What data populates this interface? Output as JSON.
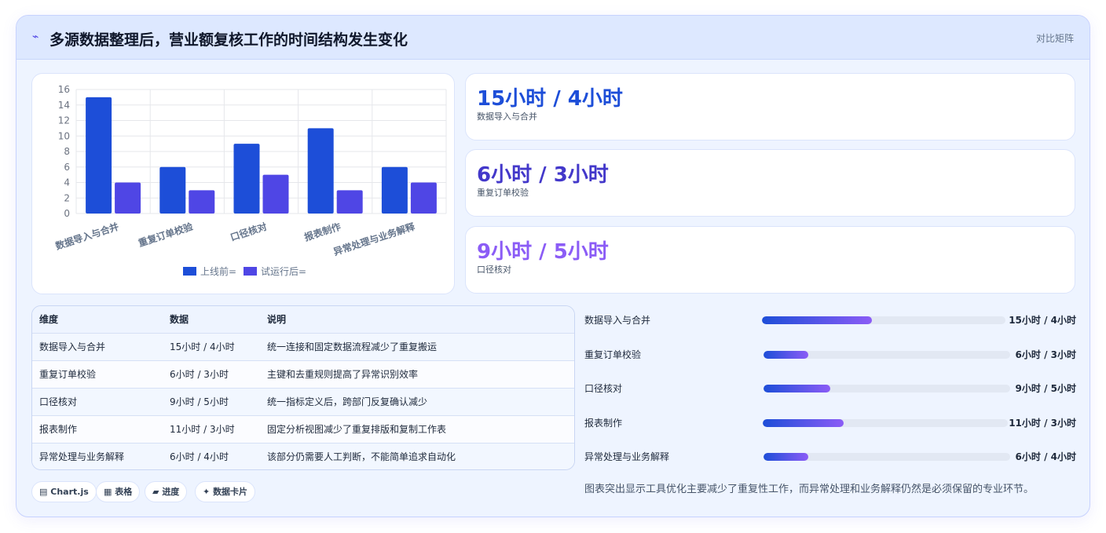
{
  "header": {
    "icon": "sparkline-icon",
    "title": "多源数据整理后，营业额复核工作的时间结构发生变化",
    "tag": "对比矩阵"
  },
  "colors": {
    "before": "#1d4ed8",
    "after": "#4f46e5",
    "stat1": "#1d4ed8",
    "stat2": "#4338ca",
    "stat3": "#8b5cf6"
  },
  "chart_data": {
    "type": "bar",
    "categories": [
      "数据导入与合并",
      "重复订单校验",
      "口径核对",
      "报表制作",
      "异常处理与业务解释"
    ],
    "series": [
      {
        "name": "上线前=",
        "values": [
          15,
          6,
          9,
          11,
          6
        ]
      },
      {
        "name": "试运行后=",
        "values": [
          4,
          3,
          5,
          3,
          4
        ]
      }
    ],
    "ylim": [
      0,
      16
    ],
    "yticks": [
      0,
      2,
      4,
      6,
      8,
      10,
      12,
      14,
      16
    ],
    "grid": true,
    "legend": "bottom"
  },
  "stats": [
    {
      "value": "15小时 / 4小时",
      "label": "数据导入与合并"
    },
    {
      "value": "6小时 / 3小时",
      "label": "重复订单校验"
    },
    {
      "value": "9小时 / 5小时",
      "label": "口径核对"
    }
  ],
  "table": {
    "headers": [
      "维度",
      "数据",
      "说明"
    ],
    "rows": [
      [
        "数据导入与合并",
        "15小时 / 4小时",
        "统一连接和固定数据流程减少了重复搬运"
      ],
      [
        "重复订单校验",
        "6小时 / 3小时",
        "主键和去重规则提高了异常识别效率"
      ],
      [
        "口径核对",
        "9小时 / 5小时",
        "统一指标定义后，跨部门反复确认减少"
      ],
      [
        "报表制作",
        "11小时 / 3小时",
        "固定分析视图减少了重复排版和复制工作表"
      ],
      [
        "异常处理与业务解释",
        "6小时 / 4小时",
        "该部分仍需要人工判断，不能简单追求自动化"
      ]
    ]
  },
  "chips": [
    {
      "icon": "chart-icon",
      "glyph": "▤",
      "label": "Chart.js"
    },
    {
      "icon": "table-icon",
      "glyph": "▦",
      "label": "表格"
    },
    {
      "icon": "progress-icon",
      "glyph": "▰",
      "label": "进度"
    },
    {
      "icon": "sparkle-icon",
      "glyph": "✦",
      "label": "数据卡片"
    }
  ],
  "progress": [
    {
      "label": "数据导入与合并",
      "value": "15小时 / 4小时",
      "fraction": 0.45
    },
    {
      "label": "重复订单校验",
      "value": "6小时 / 3小时",
      "fraction": 0.18
    },
    {
      "label": "口径核对",
      "value": "9小时 / 5小时",
      "fraction": 0.27
    },
    {
      "label": "报表制作",
      "value": "11小时 / 3小时",
      "fraction": 0.33
    },
    {
      "label": "异常处理与业务解释",
      "value": "6小时 / 4小时",
      "fraction": 0.18
    }
  ],
  "note": "图表突出显示工具优化主要减少了重复性工作，而异常处理和业务解释仍然是必须保留的专业环节。"
}
